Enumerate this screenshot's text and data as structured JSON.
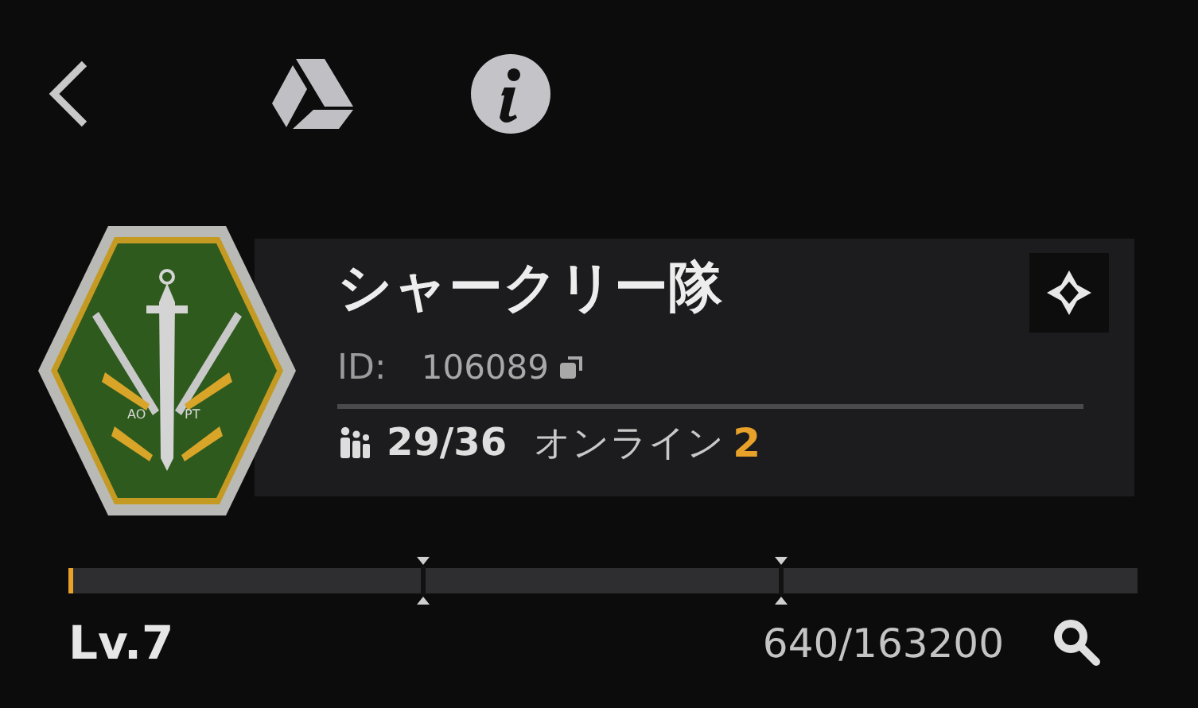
{
  "emblem": {
    "left_letters": "AO",
    "right_letters": "PT"
  },
  "clan": {
    "name": "シャークリー隊",
    "id_label": "ID:",
    "id": "106089",
    "members": "29/36",
    "online_label": "オンライン",
    "online_count": "2"
  },
  "progress": {
    "level": 0.004,
    "level_label": "Lv.7",
    "reading": "640/163200"
  }
}
